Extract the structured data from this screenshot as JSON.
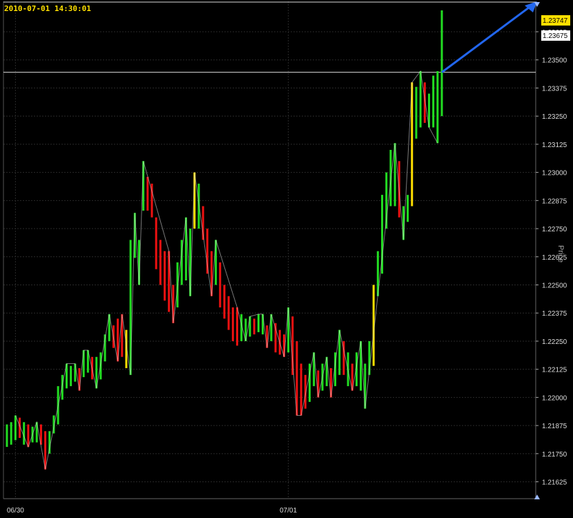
{
  "timestamp": "2010-07-01 14:30:01",
  "colors": {
    "background": "#000000",
    "grid": "#2a2a2a",
    "up": "#22dd22",
    "down": "#ee1111",
    "neutral": "#ffe000",
    "zigzag": "#dddddd",
    "arrow": "#2266ee",
    "current_price_box": "#ffe000"
  },
  "chart_data": {
    "type": "bar",
    "subtype": "ohlc-range-bars",
    "ylabel": "Price",
    "yticks": [
      1.21625,
      1.2175,
      1.21875,
      1.22,
      1.22125,
      1.2225,
      1.22375,
      1.225,
      1.22625,
      1.2275,
      1.22875,
      1.23,
      1.23125,
      1.2325,
      1.23375,
      1.235,
      1.23625
    ],
    "ytick_labels": [
      "1.21625",
      "1.21750",
      "1.21875",
      "1.22000",
      "1.22125",
      "1.22250",
      "1.22375",
      "1.22500",
      "1.22625",
      "1.22750",
      "1.22875",
      "1.23000",
      "1.23125",
      "1.23250",
      "1.23375",
      "1.23500",
      "1.23625"
    ],
    "ylim": [
      1.2155,
      1.2376
    ],
    "xlabels": [
      {
        "label": "06/30",
        "bar": 2
      },
      {
        "label": "07/01",
        "bar": 66
      }
    ],
    "price_tags": [
      {
        "value": 1.23747,
        "label": "1.23747",
        "style": "yellow"
      },
      {
        "value": 1.23675,
        "label": "1.23675",
        "style": "white"
      }
    ],
    "horizontal_lines": [
      1.23445
    ],
    "bars": [
      {
        "h": 1.2188,
        "l": 1.2178,
        "c": "g"
      },
      {
        "h": 1.2189,
        "l": 1.2179,
        "c": "g"
      },
      {
        "h": 1.2192,
        "l": 1.2181,
        "c": "g"
      },
      {
        "h": 1.2191,
        "l": 1.2182,
        "c": "r"
      },
      {
        "h": 1.2189,
        "l": 1.2179,
        "c": "g"
      },
      {
        "h": 1.2188,
        "l": 1.2178,
        "c": "r"
      },
      {
        "h": 1.2187,
        "l": 1.218,
        "c": "g"
      },
      {
        "h": 1.2189,
        "l": 1.218,
        "c": "g"
      },
      {
        "h": 1.2188,
        "l": 1.2179,
        "c": "r"
      },
      {
        "h": 1.2185,
        "l": 1.2168,
        "c": "r"
      },
      {
        "h": 1.2185,
        "l": 1.2175,
        "c": "g"
      },
      {
        "h": 1.2192,
        "l": 1.2184,
        "c": "g"
      },
      {
        "h": 1.2205,
        "l": 1.2188,
        "c": "g"
      },
      {
        "h": 1.221,
        "l": 1.2199,
        "c": "g"
      },
      {
        "h": 1.2215,
        "l": 1.2204,
        "c": "g"
      },
      {
        "h": 1.2214,
        "l": 1.2205,
        "c": "g"
      },
      {
        "h": 1.2215,
        "l": 1.2207,
        "c": "g"
      },
      {
        "h": 1.2213,
        "l": 1.2203,
        "c": "r"
      },
      {
        "h": 1.2221,
        "l": 1.2209,
        "c": "g"
      },
      {
        "h": 1.2221,
        "l": 1.2211,
        "c": "g"
      },
      {
        "h": 1.2218,
        "l": 1.2208,
        "c": "r"
      },
      {
        "h": 1.2218,
        "l": 1.2204,
        "c": "g"
      },
      {
        "h": 1.222,
        "l": 1.2208,
        "c": "g"
      },
      {
        "h": 1.2228,
        "l": 1.2216,
        "c": "g"
      },
      {
        "h": 1.2237,
        "l": 1.2225,
        "c": "g"
      },
      {
        "h": 1.2232,
        "l": 1.2222,
        "c": "r"
      },
      {
        "h": 1.2235,
        "l": 1.2216,
        "c": "r"
      },
      {
        "h": 1.2237,
        "l": 1.2218,
        "c": "r"
      },
      {
        "h": 1.223,
        "l": 1.2213,
        "c": "y"
      },
      {
        "h": 1.227,
        "l": 1.221,
        "c": "g"
      },
      {
        "h": 1.2282,
        "l": 1.2262,
        "c": "g"
      },
      {
        "h": 1.227,
        "l": 1.225,
        "c": "g"
      },
      {
        "h": 1.2305,
        "l": 1.2283,
        "c": "g"
      },
      {
        "h": 1.2298,
        "l": 1.2283,
        "c": "r"
      },
      {
        "h": 1.2295,
        "l": 1.228,
        "c": "r"
      },
      {
        "h": 1.228,
        "l": 1.2257,
        "c": "r"
      },
      {
        "h": 1.227,
        "l": 1.225,
        "c": "r"
      },
      {
        "h": 1.2265,
        "l": 1.2243,
        "c": "r"
      },
      {
        "h": 1.2265,
        "l": 1.2238,
        "c": "r"
      },
      {
        "h": 1.225,
        "l": 1.2233,
        "c": "r"
      },
      {
        "h": 1.226,
        "l": 1.224,
        "c": "g"
      },
      {
        "h": 1.227,
        "l": 1.225,
        "c": "g"
      },
      {
        "h": 1.228,
        "l": 1.2252,
        "c": "g"
      },
      {
        "h": 1.2275,
        "l": 1.2245,
        "c": "g"
      },
      {
        "h": 1.23,
        "l": 1.2275,
        "c": "y"
      },
      {
        "h": 1.2295,
        "l": 1.2275,
        "c": "g"
      },
      {
        "h": 1.2285,
        "l": 1.227,
        "c": "r"
      },
      {
        "h": 1.2275,
        "l": 1.2255,
        "c": "r"
      },
      {
        "h": 1.2265,
        "l": 1.2245,
        "c": "r"
      },
      {
        "h": 1.227,
        "l": 1.225,
        "c": "g"
      },
      {
        "h": 1.226,
        "l": 1.224,
        "c": "r"
      },
      {
        "h": 1.225,
        "l": 1.2235,
        "c": "r"
      },
      {
        "h": 1.2245,
        "l": 1.223,
        "c": "r"
      },
      {
        "h": 1.224,
        "l": 1.2225,
        "c": "r"
      },
      {
        "h": 1.224,
        "l": 1.2223,
        "c": "r"
      },
      {
        "h": 1.2237,
        "l": 1.2225,
        "c": "g"
      },
      {
        "h": 1.2235,
        "l": 1.2225,
        "c": "g"
      },
      {
        "h": 1.2236,
        "l": 1.2227,
        "c": "g"
      },
      {
        "h": 1.2235,
        "l": 1.2228,
        "c": "r"
      },
      {
        "h": 1.2237,
        "l": 1.2229,
        "c": "g"
      },
      {
        "h": 1.2237,
        "l": 1.2228,
        "c": "g"
      },
      {
        "h": 1.2232,
        "l": 1.2222,
        "c": "r"
      },
      {
        "h": 1.2237,
        "l": 1.2225,
        "c": "g"
      },
      {
        "h": 1.2233,
        "l": 1.222,
        "c": "r"
      },
      {
        "h": 1.223,
        "l": 1.2219,
        "c": "r"
      },
      {
        "h": 1.2228,
        "l": 1.2218,
        "c": "r"
      },
      {
        "h": 1.224,
        "l": 1.222,
        "c": "g"
      },
      {
        "h": 1.2236,
        "l": 1.221,
        "c": "r"
      },
      {
        "h": 1.2225,
        "l": 1.2192,
        "c": "r"
      },
      {
        "h": 1.2215,
        "l": 1.2192,
        "c": "r"
      },
      {
        "h": 1.221,
        "l": 1.2195,
        "c": "r"
      },
      {
        "h": 1.2215,
        "l": 1.2198,
        "c": "g"
      },
      {
        "h": 1.222,
        "l": 1.2205,
        "c": "g"
      },
      {
        "h": 1.2212,
        "l": 1.22,
        "c": "r"
      },
      {
        "h": 1.2215,
        "l": 1.2203,
        "c": "g"
      },
      {
        "h": 1.2218,
        "l": 1.2205,
        "c": "g"
      },
      {
        "h": 1.2213,
        "l": 1.22,
        "c": "r"
      },
      {
        "h": 1.222,
        "l": 1.2205,
        "c": "g"
      },
      {
        "h": 1.223,
        "l": 1.221,
        "c": "g"
      },
      {
        "h": 1.2225,
        "l": 1.221,
        "c": "r"
      },
      {
        "h": 1.222,
        "l": 1.2205,
        "c": "g"
      },
      {
        "h": 1.2215,
        "l": 1.2203,
        "c": "r"
      },
      {
        "h": 1.222,
        "l": 1.2205,
        "c": "g"
      },
      {
        "h": 1.2225,
        "l": 1.2203,
        "c": "g"
      },
      {
        "h": 1.2215,
        "l": 1.2195,
        "c": "g"
      },
      {
        "h": 1.2225,
        "l": 1.221,
        "c": "g"
      },
      {
        "h": 1.225,
        "l": 1.2214,
        "c": "y"
      },
      {
        "h": 1.2265,
        "l": 1.2245,
        "c": "g"
      },
      {
        "h": 1.229,
        "l": 1.2255,
        "c": "g"
      },
      {
        "h": 1.23,
        "l": 1.2275,
        "c": "g"
      },
      {
        "h": 1.231,
        "l": 1.2285,
        "c": "g"
      },
      {
        "h": 1.2313,
        "l": 1.2285,
        "c": "g"
      },
      {
        "h": 1.2305,
        "l": 1.228,
        "c": "r"
      },
      {
        "h": 1.2285,
        "l": 1.227,
        "c": "g"
      },
      {
        "h": 1.229,
        "l": 1.2278,
        "c": "g"
      },
      {
        "h": 1.234,
        "l": 1.2285,
        "c": "y"
      },
      {
        "h": 1.2338,
        "l": 1.2315,
        "c": "g"
      },
      {
        "h": 1.2345,
        "l": 1.232,
        "c": "g"
      },
      {
        "h": 1.234,
        "l": 1.2322,
        "c": "r"
      },
      {
        "h": 1.2335,
        "l": 1.232,
        "c": "g"
      },
      {
        "h": 1.2343,
        "l": 1.232,
        "c": "g"
      },
      {
        "h": 1.2345,
        "l": 1.2313,
        "c": "g"
      },
      {
        "h": 1.2372,
        "l": 1.2325,
        "c": "g"
      }
    ]
  }
}
